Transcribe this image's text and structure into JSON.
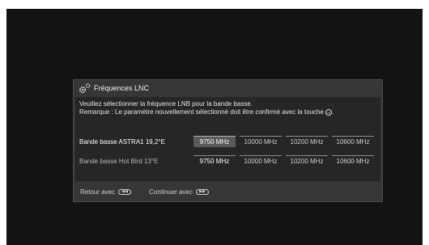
{
  "dialog": {
    "title": "Fréquences LNC",
    "instruction_line1": "Veuillez sélectionner la fréquence LNB pour la bande basse.",
    "instruction_line2": "Remarque : Le paramètre nouvellement sélectionné doit être confirmé avec la touche",
    "ok_key_glyph": "OK"
  },
  "rows": [
    {
      "label": "Bande basse ASTRA1 19,2°E",
      "options": [
        "9750 MHz",
        "10000 MHz",
        "10200 MHz",
        "10600 MHz"
      ],
      "selected": "9750 MHz",
      "focused": true
    },
    {
      "label": "Bande basse Hot Bird 13°E",
      "options": [
        "9750 MHz",
        "10000 MHz",
        "10200 MHz",
        "10600 MHz"
      ],
      "selected": "9750 MHz",
      "focused": false
    }
  ],
  "footer": {
    "back_label": "Retour avec",
    "back_key_glyph": "◀◀",
    "continue_label": "Continuer avec",
    "continue_key_glyph": "▶▶"
  }
}
